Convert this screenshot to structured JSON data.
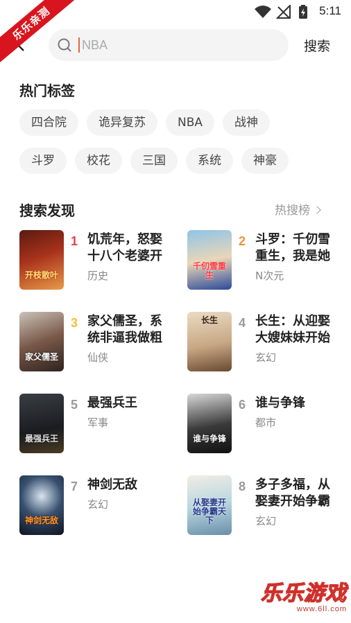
{
  "status_bar": {
    "time": "5:11"
  },
  "ribbon": {
    "text": "乐乐亲测"
  },
  "search": {
    "placeholder": "NBA",
    "button_label": "搜索"
  },
  "hot_tags": {
    "title": "热门标签",
    "rows": [
      [
        "四合院",
        "诡异复苏",
        "NBA",
        "战神"
      ],
      [
        "斗罗",
        "校花",
        "三国",
        "系统",
        "神豪"
      ]
    ]
  },
  "discover": {
    "title": "搜索发现",
    "hot_link": "热搜榜",
    "books": [
      {
        "rank": "1",
        "title": "饥荒年，怒娶十八个老婆开",
        "genre": "历史",
        "cover_text": "开枝散叶"
      },
      {
        "rank": "2",
        "title": "斗罗：千仞雪重生，我是她",
        "genre": "N次元",
        "cover_text": "千仞雪重生"
      },
      {
        "rank": "3",
        "title": "家父儒圣，系统非逼我做粗",
        "genre": "仙侠",
        "cover_text": "家父儒圣"
      },
      {
        "rank": "4",
        "title": "长生：从迎娶大嫂妹妹开始",
        "genre": "玄幻",
        "cover_text": "长生"
      },
      {
        "rank": "5",
        "title": "最强兵王",
        "genre": "军事",
        "cover_text": "最强兵王"
      },
      {
        "rank": "6",
        "title": "谁与争锋",
        "genre": "都市",
        "cover_text": "谁与争锋"
      },
      {
        "rank": "7",
        "title": "神剑无敌",
        "genre": "玄幻",
        "cover_text": "神剑无敌"
      },
      {
        "rank": "8",
        "title": "多子多福，从娶妻开始争霸",
        "genre": "玄幻",
        "cover_text": "从娶妻开始争霸天下"
      }
    ]
  },
  "watermark": {
    "main": "乐乐游戏",
    "sub": "www.6ll.com"
  },
  "colors": {
    "rank1": "#e8404a",
    "rank2": "#f0923a",
    "rank3": "#f2c232",
    "rank_other": "#9a9a9a",
    "tag_bg": "#f4f4f4",
    "search_caret": "#e8663a"
  }
}
